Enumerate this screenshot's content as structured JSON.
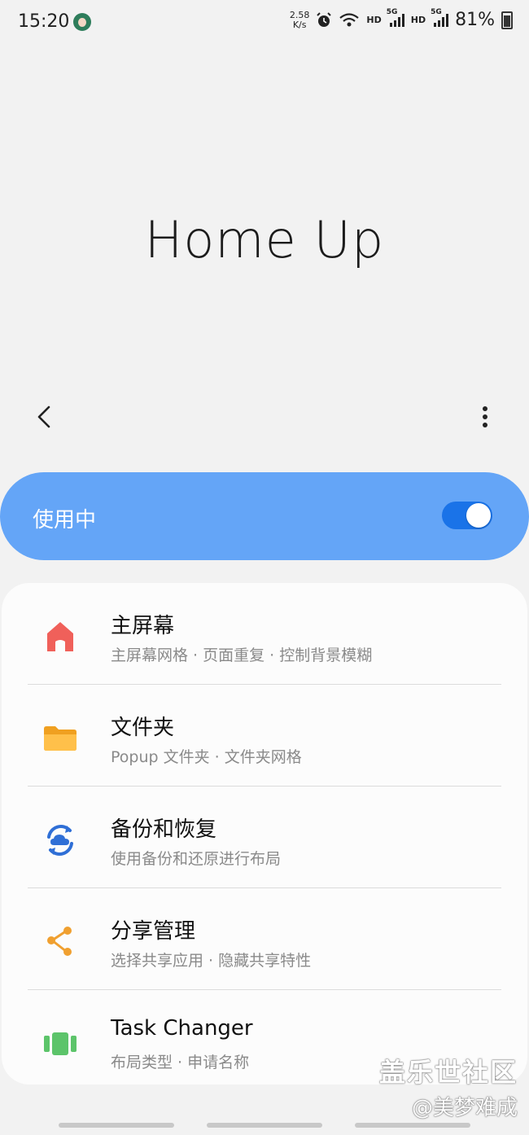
{
  "status_bar": {
    "time": "15:20",
    "speed_value": "2.58",
    "speed_unit": "K/s",
    "hd1": "HD",
    "signal1": "5G",
    "hd2": "HD",
    "signal2": "5G",
    "battery": "81%",
    "icons": [
      "alarm-icon",
      "wifi-icon",
      "signal-icon",
      "battery-icon"
    ]
  },
  "page": {
    "title": "Home Up"
  },
  "toggle": {
    "label": "使用中",
    "enabled": true,
    "accent_color": "#1a73e8",
    "bar_color": "#64a5f7"
  },
  "menu": [
    {
      "title": "主屏幕",
      "subtitle": "主屏幕网格 · 页面重复 · 控制背景模糊",
      "icon": "home-icon",
      "color": "#f0605a"
    },
    {
      "title": "文件夹",
      "subtitle": "Popup 文件夹 · 文件夹网格",
      "icon": "folder-icon",
      "color": "#f5a623"
    },
    {
      "title": "备份和恢复",
      "subtitle": "使用备份和还原进行布局",
      "icon": "cloud-sync-icon",
      "color": "#2f6fd6"
    },
    {
      "title": "分享管理",
      "subtitle": "选择共享应用 · 隐藏共享特性",
      "icon": "share-icon",
      "color": "#f0a030"
    },
    {
      "title": "Task Changer",
      "subtitle": "布局类型 · 申请名称",
      "icon": "task-changer-icon",
      "color": "#5cc46a"
    }
  ],
  "watermark": {
    "line1": "盖乐世社区",
    "line2": "@美梦难成"
  }
}
